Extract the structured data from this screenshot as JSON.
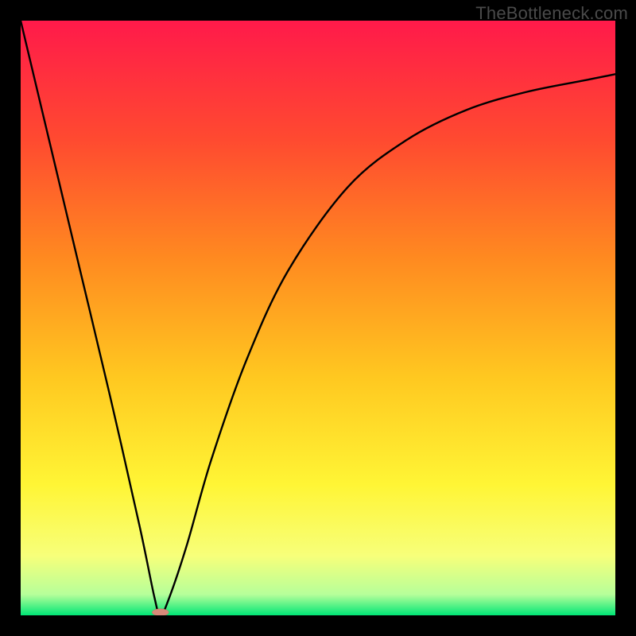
{
  "attribution": "TheBottleneck.com",
  "chart_data": {
    "type": "line",
    "title": "",
    "xlabel": "",
    "ylabel": "",
    "xlim": [
      0,
      1
    ],
    "ylim": [
      0,
      1
    ],
    "grid": false,
    "legend": false,
    "background": {
      "type": "vertical-gradient",
      "stops": [
        {
          "pos": 0.0,
          "color": "#ff1a4a"
        },
        {
          "pos": 0.2,
          "color": "#ff4a30"
        },
        {
          "pos": 0.4,
          "color": "#ff8a20"
        },
        {
          "pos": 0.6,
          "color": "#ffc820"
        },
        {
          "pos": 0.78,
          "color": "#fff535"
        },
        {
          "pos": 0.9,
          "color": "#f7ff7a"
        },
        {
          "pos": 0.965,
          "color": "#b6ff9a"
        },
        {
          "pos": 1.0,
          "color": "#00e676"
        }
      ]
    },
    "series": [
      {
        "name": "bottleneck-curve",
        "color": "#000000",
        "x": [
          0.0,
          0.05,
          0.1,
          0.15,
          0.2,
          0.225,
          0.235,
          0.25,
          0.28,
          0.32,
          0.38,
          0.45,
          0.55,
          0.65,
          0.75,
          0.85,
          0.95,
          1.0
        ],
        "y": [
          1.0,
          0.79,
          0.58,
          0.37,
          0.15,
          0.03,
          0.0,
          0.03,
          0.12,
          0.26,
          0.43,
          0.58,
          0.72,
          0.8,
          0.85,
          0.88,
          0.9,
          0.91
        ]
      }
    ],
    "markers": [
      {
        "name": "minimum-pill",
        "x": 0.235,
        "y": 0.005,
        "color": "#d88a7a",
        "shape": "pill",
        "size": [
          0.028,
          0.012
        ]
      }
    ]
  }
}
